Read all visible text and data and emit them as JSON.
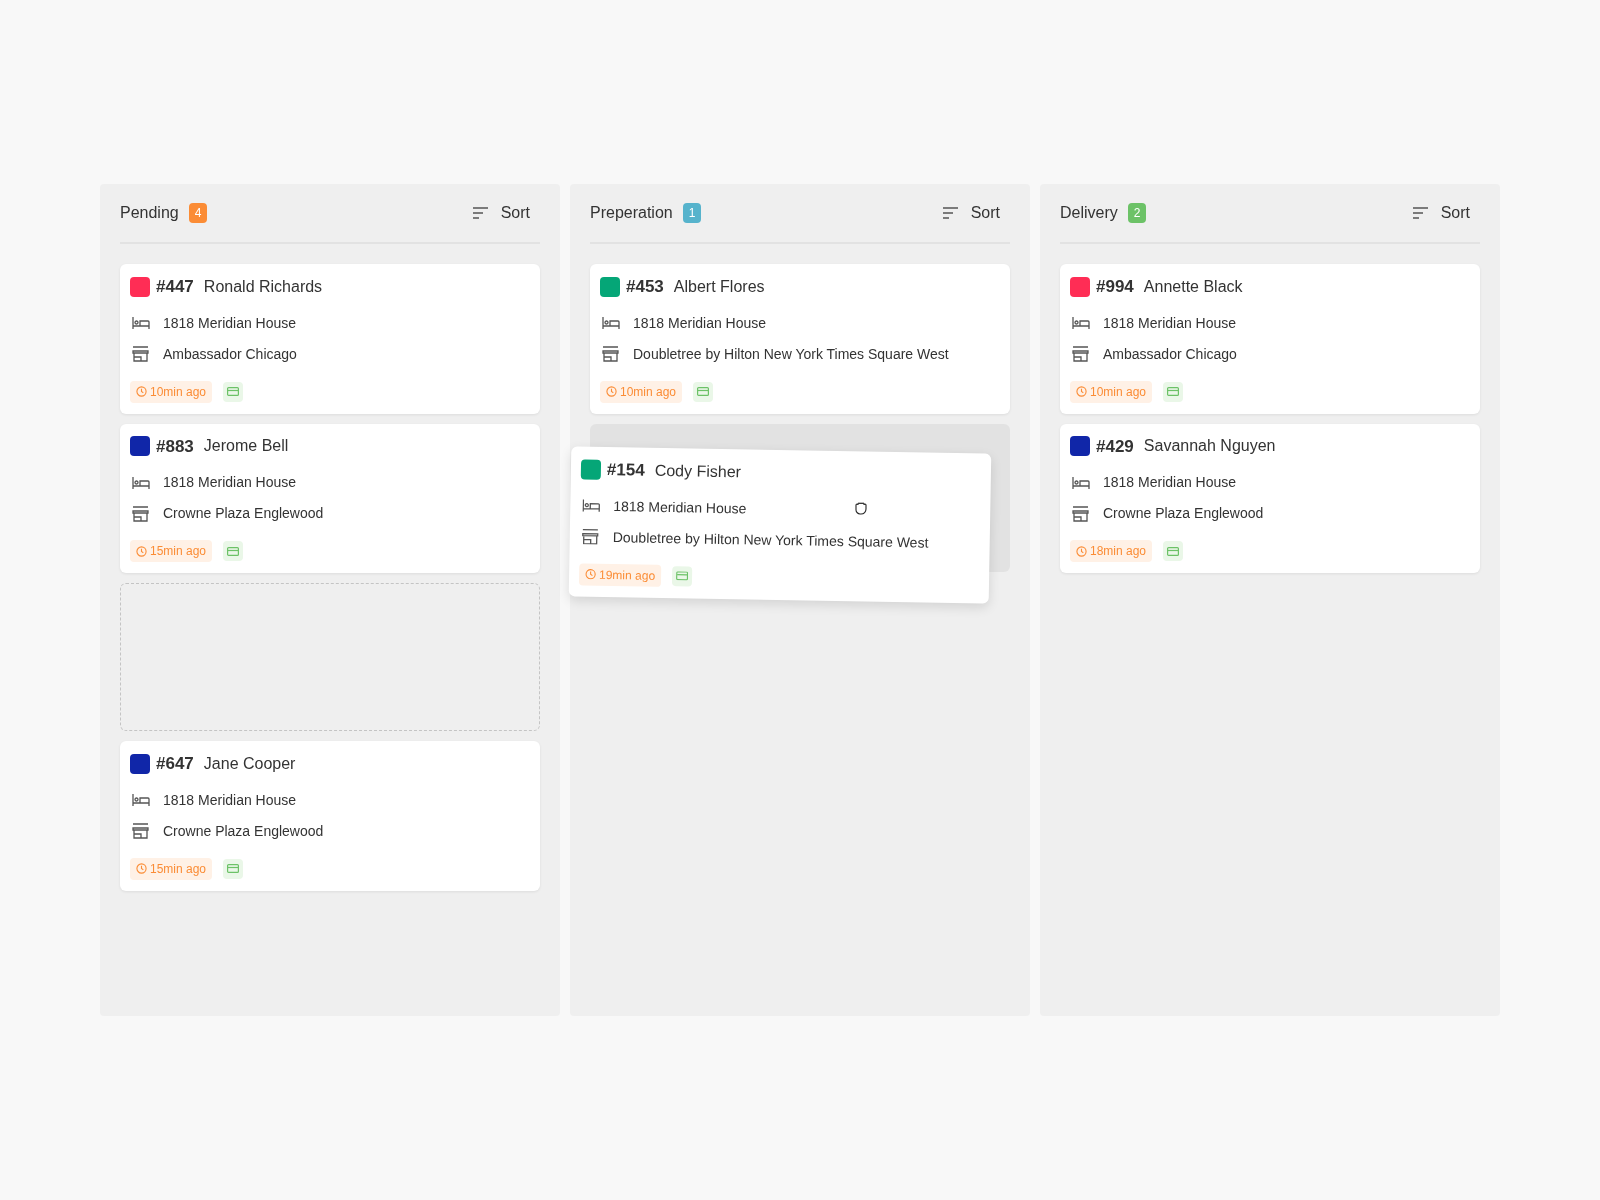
{
  "columns": [
    {
      "title": "Pending",
      "count": "4",
      "color": "#fb8c35",
      "sort": "Sort",
      "items": [
        {
          "kind": "card",
          "number": "#447",
          "name": "Ronald Richards",
          "color": "#ff2d55",
          "hotel": "1818 Meridian House",
          "venue": "Ambassador Chicago",
          "time": "10min ago"
        },
        {
          "kind": "card",
          "number": "#883",
          "name": "Jerome Bell",
          "color": "#1026a8",
          "hotel": "1818 Meridian House",
          "venue": "Crowne Plaza Englewood",
          "time": "15min ago"
        },
        {
          "kind": "dropzone"
        },
        {
          "kind": "card",
          "number": "#647",
          "name": "Jane Cooper",
          "color": "#1026a8",
          "hotel": "1818 Meridian House",
          "venue": "Crowne Plaza Englewood",
          "time": "15min ago"
        }
      ]
    },
    {
      "title": "Preperation",
      "count": "1",
      "color": "#56b3cc",
      "sort": "Sort",
      "items": [
        {
          "kind": "card",
          "number": "#453",
          "name": "Albert Flores",
          "color": "#05a677",
          "hotel": "1818 Meridian House",
          "venue": "Doubletree by Hilton New York Times Square West",
          "time": "10min ago"
        },
        {
          "kind": "slot"
        }
      ],
      "dragged": {
        "number": "#154",
        "name": "Cody Fisher",
        "color": "#05a677",
        "hotel": "1818 Meridian House",
        "venue": "Doubletree by Hilton New York Times Square West",
        "time": "19min ago"
      }
    },
    {
      "title": "Delivery",
      "count": "2",
      "color": "#6cc267",
      "sort": "Sort",
      "items": [
        {
          "kind": "card",
          "number": "#994",
          "name": "Annette Black",
          "color": "#ff2d55",
          "hotel": "1818 Meridian House",
          "venue": "Ambassador Chicago",
          "time": "10min ago"
        },
        {
          "kind": "card",
          "number": "#429",
          "name": "Savannah Nguyen",
          "color": "#1026a8",
          "hotel": "1818 Meridian House",
          "venue": "Crowne Plaza Englewood",
          "time": "18min ago"
        }
      ]
    }
  ]
}
